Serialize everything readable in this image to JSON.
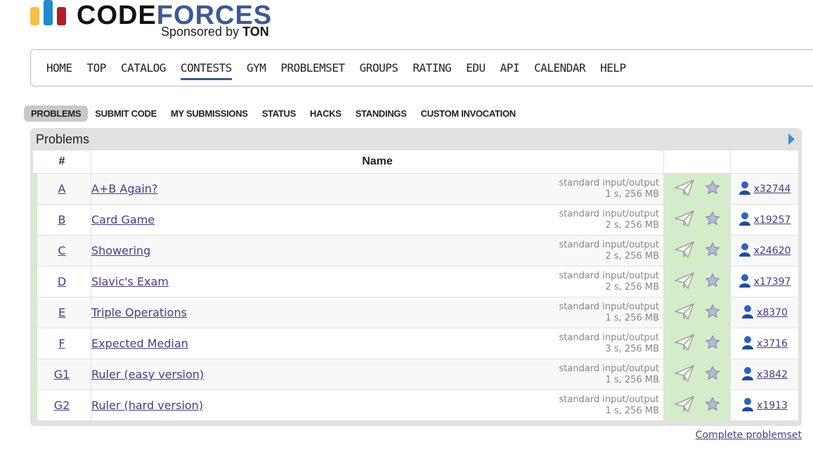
{
  "logo": {
    "code": "CODE",
    "forces": "FORCES",
    "sponsor_prefix": "Sponsored by",
    "sponsor_name": "TON"
  },
  "menu": [
    "HOME",
    "TOP",
    "CATALOG",
    "CONTESTS",
    "GYM",
    "PROBLEMSET",
    "GROUPS",
    "RATING",
    "EDU",
    "API",
    "CALENDAR",
    "HELP"
  ],
  "menu_active": "CONTESTS",
  "submenu": [
    "PROBLEMS",
    "SUBMIT CODE",
    "MY SUBMISSIONS",
    "STATUS",
    "HACKS",
    "STANDINGS",
    "CUSTOM INVOCATION"
  ],
  "submenu_active": "PROBLEMS",
  "box": {
    "title": "Problems"
  },
  "table": {
    "headers": {
      "index": "#",
      "name": "Name"
    },
    "rows": [
      {
        "index": "A",
        "name": "A+B Again?",
        "io": "standard input/output",
        "limits": "1 s, 256 MB",
        "solved": "x32744"
      },
      {
        "index": "B",
        "name": "Card Game",
        "io": "standard input/output",
        "limits": "2 s, 256 MB",
        "solved": "x19257"
      },
      {
        "index": "C",
        "name": "Showering",
        "io": "standard input/output",
        "limits": "2 s, 256 MB",
        "solved": "x24620"
      },
      {
        "index": "D",
        "name": "Slavic's Exam",
        "io": "standard input/output",
        "limits": "2 s, 256 MB",
        "solved": "x17397"
      },
      {
        "index": "E",
        "name": "Triple Operations",
        "io": "standard input/output",
        "limits": "1 s, 256 MB",
        "solved": "x8370"
      },
      {
        "index": "F",
        "name": "Expected Median",
        "io": "standard input/output",
        "limits": "3 s, 256 MB",
        "solved": "x3716"
      },
      {
        "index": "G1",
        "name": "Ruler (easy version)",
        "io": "standard input/output",
        "limits": "1 s, 256 MB",
        "solved": "x3842"
      },
      {
        "index": "G2",
        "name": "Ruler (hard version)",
        "io": "standard input/output",
        "limits": "1 s, 256 MB",
        "solved": "x1913"
      }
    ]
  },
  "icons": {
    "submit": "paper-plane-icon",
    "favourite": "star-icon",
    "solvers": "user-icon",
    "next": "arrow-right-icon"
  },
  "colors": {
    "brand_blue": "#3b5998",
    "accepted_green": "#d4edc9",
    "link": "#4b3a8a"
  },
  "footer": {
    "complete_link": "Complete problemset"
  }
}
